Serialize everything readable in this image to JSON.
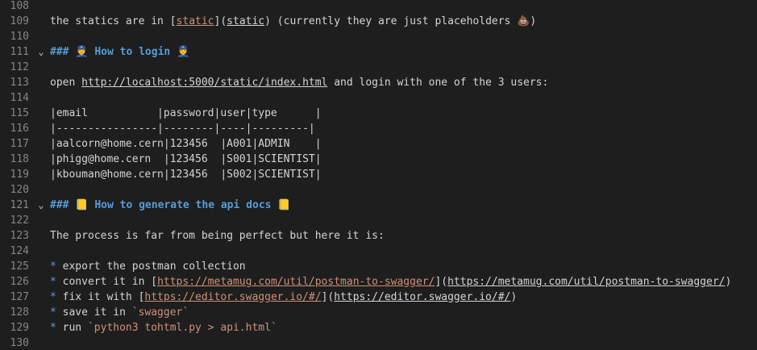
{
  "lines": [
    {
      "n": "108",
      "fold": "",
      "parts": []
    },
    {
      "n": "109",
      "fold": "",
      "parts": [
        {
          "t": "the statics are in [",
          "c": ""
        },
        {
          "t": "static",
          "c": "link-text"
        },
        {
          "t": "](",
          "c": ""
        },
        {
          "t": "static",
          "c": "link-url"
        },
        {
          "t": ") (currently they are just placeholders 💩)",
          "c": ""
        }
      ]
    },
    {
      "n": "110",
      "fold": "",
      "parts": []
    },
    {
      "n": "111",
      "fold": "⌄",
      "parts": [
        {
          "t": "### 👮 How to login 👮",
          "c": "heading"
        }
      ]
    },
    {
      "n": "112",
      "fold": "",
      "parts": []
    },
    {
      "n": "113",
      "fold": "",
      "parts": [
        {
          "t": "open ",
          "c": ""
        },
        {
          "t": "http://localhost:5000/static/index.html",
          "c": "plain-link"
        },
        {
          "t": " and login with one of the 3 users:",
          "c": ""
        }
      ]
    },
    {
      "n": "114",
      "fold": "",
      "parts": []
    },
    {
      "n": "115",
      "fold": "",
      "parts": [
        {
          "t": "|email           |password|user|type      |",
          "c": "table-text"
        }
      ]
    },
    {
      "n": "116",
      "fold": "",
      "parts": [
        {
          "t": "|----------------|--------|----|---------|",
          "c": "table-text"
        }
      ]
    },
    {
      "n": "117",
      "fold": "",
      "parts": [
        {
          "t": "|aalcorn@home.cern|123456  |A001|ADMIN    |",
          "c": "table-text"
        }
      ]
    },
    {
      "n": "118",
      "fold": "",
      "parts": [
        {
          "t": "|phigg@home.cern  |123456  |S001|SCIENTIST|",
          "c": "table-text"
        }
      ]
    },
    {
      "n": "119",
      "fold": "",
      "parts": [
        {
          "t": "|kbouman@home.cern|123456  |S002|SCIENTIST|",
          "c": "table-text"
        }
      ]
    },
    {
      "n": "120",
      "fold": "",
      "parts": []
    },
    {
      "n": "121",
      "fold": "⌄",
      "parts": [
        {
          "t": "### 📒 How to generate the api docs 📒",
          "c": "heading"
        }
      ]
    },
    {
      "n": "122",
      "fold": "",
      "parts": []
    },
    {
      "n": "123",
      "fold": "",
      "parts": [
        {
          "t": "The process is far from being perfect but here it is:",
          "c": ""
        }
      ]
    },
    {
      "n": "124",
      "fold": "",
      "parts": []
    },
    {
      "n": "125",
      "fold": "",
      "parts": [
        {
          "t": "* ",
          "c": "bullet"
        },
        {
          "t": "export the postman collection",
          "c": ""
        }
      ]
    },
    {
      "n": "126",
      "fold": "",
      "parts": [
        {
          "t": "* ",
          "c": "bullet"
        },
        {
          "t": "convert it in [",
          "c": ""
        },
        {
          "t": "https://metamug.com/util/postman-to-swagger/",
          "c": "link-text"
        },
        {
          "t": "](",
          "c": ""
        },
        {
          "t": "https://metamug.com/util/postman-to-swagger/",
          "c": "link-url"
        },
        {
          "t": ")",
          "c": ""
        }
      ]
    },
    {
      "n": "127",
      "fold": "",
      "parts": [
        {
          "t": "* ",
          "c": "bullet"
        },
        {
          "t": "fix it with [",
          "c": ""
        },
        {
          "t": "https://editor.swagger.io/#/",
          "c": "link-text"
        },
        {
          "t": "](",
          "c": ""
        },
        {
          "t": "https://editor.swagger.io/#/",
          "c": "link-url"
        },
        {
          "t": ")",
          "c": ""
        }
      ]
    },
    {
      "n": "128",
      "fold": "",
      "parts": [
        {
          "t": "* ",
          "c": "bullet"
        },
        {
          "t": "save it in ",
          "c": ""
        },
        {
          "t": "`swagger`",
          "c": "inline-code"
        }
      ]
    },
    {
      "n": "129",
      "fold": "",
      "parts": [
        {
          "t": "* ",
          "c": "bullet"
        },
        {
          "t": "run ",
          "c": ""
        },
        {
          "t": "`python3 tohtml.py > api.html`",
          "c": "inline-code"
        }
      ]
    },
    {
      "n": "130",
      "fold": "",
      "parts": []
    }
  ]
}
